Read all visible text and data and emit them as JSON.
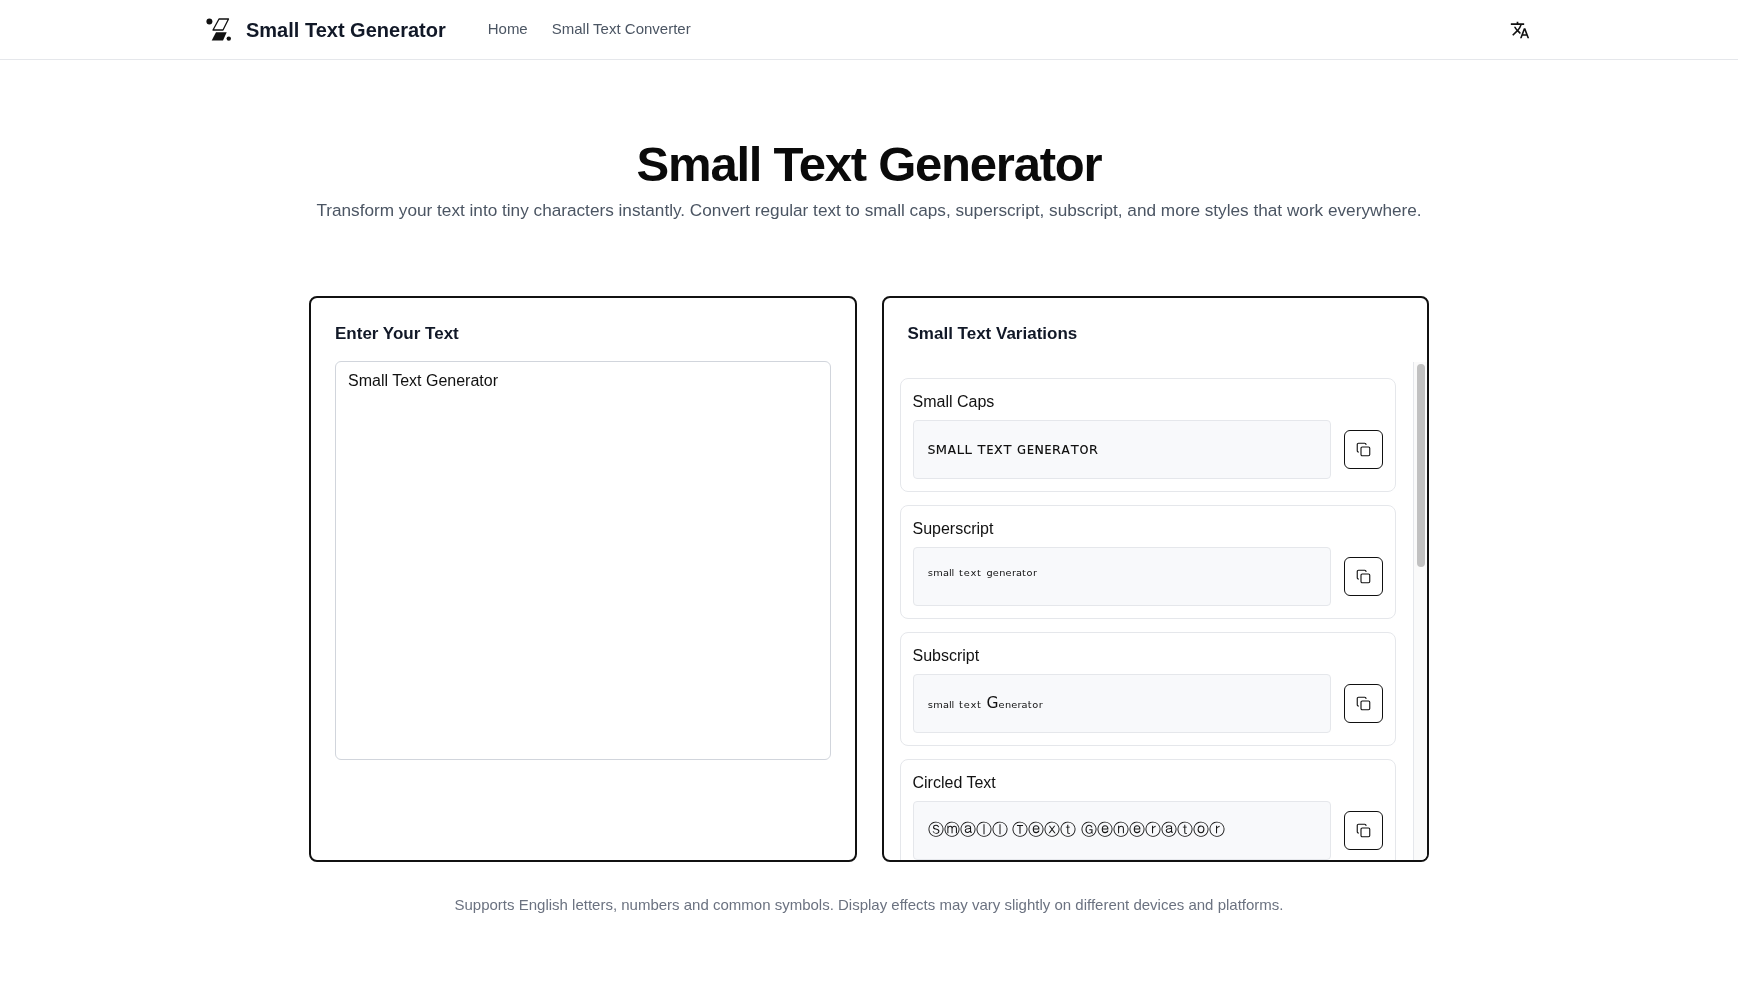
{
  "header": {
    "brand": "Small Text Generator",
    "nav": [
      {
        "label": "Home"
      },
      {
        "label": "Small Text Converter"
      }
    ]
  },
  "hero": {
    "title": "Small Text Generator",
    "subtitle": "Transform your text into tiny characters instantly. Convert regular text to small caps, superscript, subscript, and more styles that work everywhere."
  },
  "input_panel": {
    "title": "Enter Your Text",
    "value": "Small Text Generator"
  },
  "variations_panel": {
    "title": "Small Text Variations",
    "items": [
      {
        "label": "Small Caps",
        "value": "ꜱᴍᴀʟʟ ᴛᴇxᴛ ɢᴇɴᴇʀᴀᴛᴏʀ"
      },
      {
        "label": "Superscript",
        "value": "ˢᵐᵃˡˡ ᵗᵉˣᵗ ᵍᵉⁿᵉʳᵃᵗᵒʳ"
      },
      {
        "label": "Subscript",
        "value": "ₛₘₐₗₗ ₜₑₓₜ Gₑₙₑᵣₐₜₒᵣ"
      },
      {
        "label": "Circled Text",
        "value": "Ⓢⓜⓐⓛⓛ Ⓣⓔⓧⓣ Ⓖⓔⓝⓔⓡⓐⓣⓞⓡ"
      }
    ]
  },
  "footer_note": "Supports English letters, numbers and common symbols. Display effects may vary slightly on different devices and platforms."
}
